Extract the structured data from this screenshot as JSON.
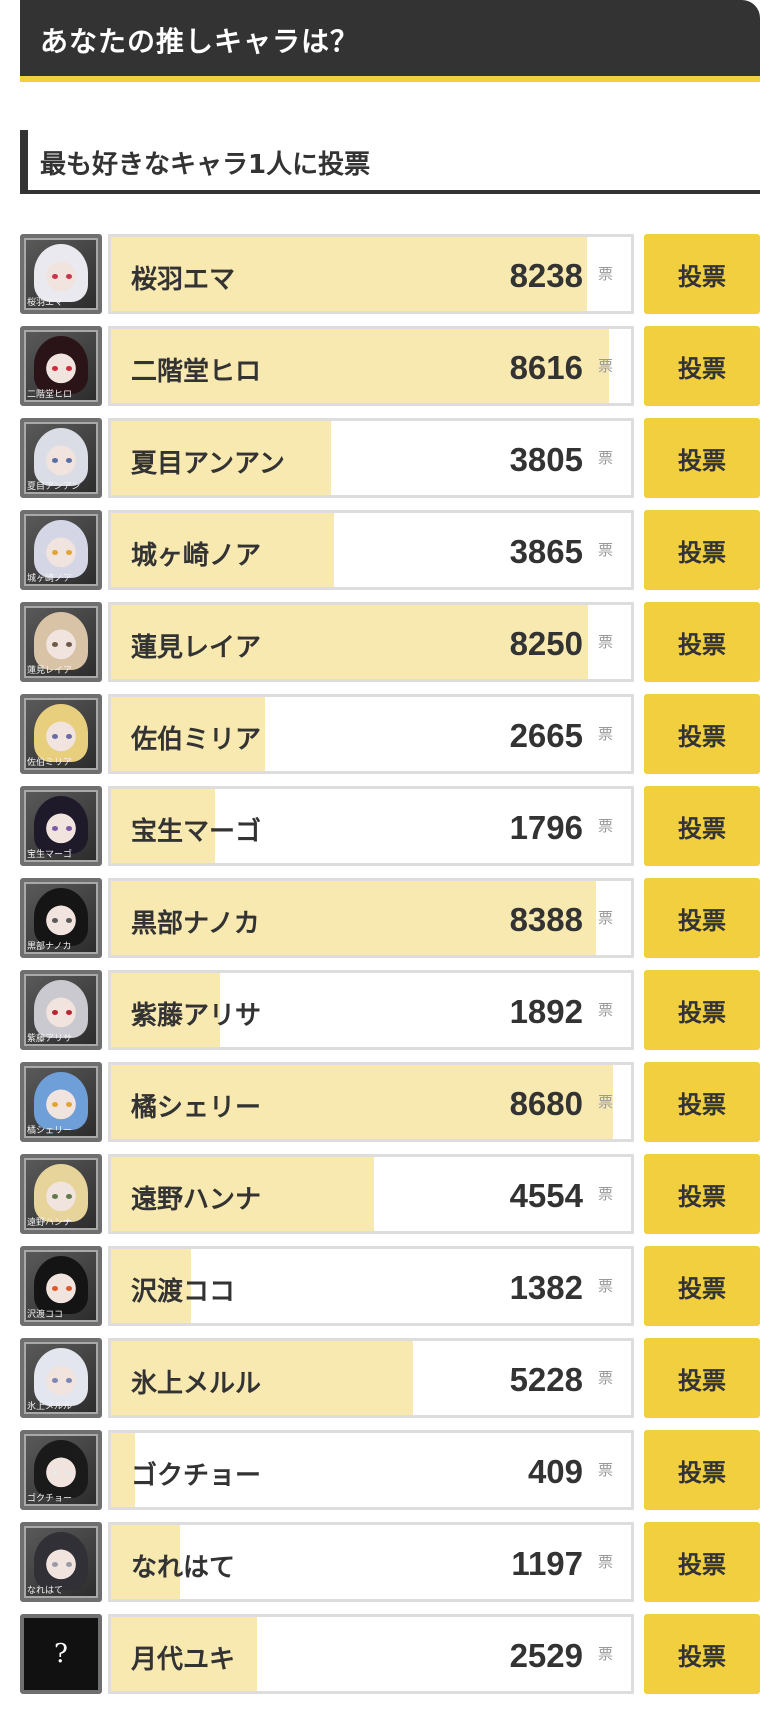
{
  "header": {
    "title": "あなたの推しキャラは？"
  },
  "subheading": {
    "title": "最も好きなキャラ1人に投票"
  },
  "vote_unit": "票",
  "vote_button_label": "投票",
  "max_votes": 9000,
  "characters": [
    {
      "name": "桜羽エマ",
      "votes": "8238",
      "tag": "桜羽エマ",
      "hair": "#e9e9ef",
      "eye": "#c8344a"
    },
    {
      "name": "二階堂ヒロ",
      "votes": "8616",
      "tag": "二階堂ヒロ",
      "hair": "#2a1418",
      "eye": "#d12a3c"
    },
    {
      "name": "夏目アンアン",
      "votes": "3805",
      "tag": "夏目アンアン",
      "hair": "#dadde6",
      "eye": "#5a6fa8"
    },
    {
      "name": "城ヶ崎ノア",
      "votes": "3865",
      "tag": "城ヶ崎ノア",
      "hair": "#d4d6e6",
      "eye": "#e1a531"
    },
    {
      "name": "蓮見レイア",
      "votes": "8250",
      "tag": "蓮見レイア",
      "hair": "#d8c3a6",
      "eye": "#6f5a4a"
    },
    {
      "name": "佐伯ミリア",
      "votes": "2665",
      "tag": "佐伯ミリア",
      "hair": "#e8cf7d",
      "eye": "#6c6aa8"
    },
    {
      "name": "宝生マーゴ",
      "votes": "1796",
      "tag": "宝生マーゴ",
      "hair": "#1f1a2a",
      "eye": "#7d5aa8"
    },
    {
      "name": "黒部ナノカ",
      "votes": "8388",
      "tag": "黒部ナノカ",
      "hair": "#151515",
      "eye": "#5a5a5a"
    },
    {
      "name": "紫藤アリサ",
      "votes": "1892",
      "tag": "紫藤アリサ",
      "hair": "#c9c9cf",
      "eye": "#b8252f"
    },
    {
      "name": "橘シェリー",
      "votes": "8680",
      "tag": "橘シェリー",
      "hair": "#6f9fd8",
      "eye": "#e1a531"
    },
    {
      "name": "遠野ハンナ",
      "votes": "4554",
      "tag": "遠野ハンナ",
      "hair": "#e7d49a",
      "eye": "#5f7c4a"
    },
    {
      "name": "沢渡ココ",
      "votes": "1382",
      "tag": "沢渡ココ",
      "hair": "#141414",
      "eye": "#e0592a"
    },
    {
      "name": "氷上メルル",
      "votes": "5228",
      "tag": "氷上メルル",
      "hair": "#e3e6ee",
      "eye": "#7a86b3"
    },
    {
      "name": "ゴクチョー",
      "votes": "409",
      "tag": "ゴクチョー",
      "hair": "#1a1a1a",
      "eye": "#e8e8e8"
    },
    {
      "name": "なれはて",
      "votes": "1197",
      "tag": "なれはて",
      "hair": "#303036",
      "eye": "#9a9aa8"
    },
    {
      "name": "月代ユキ",
      "votes": "2529",
      "tag": "?",
      "hair": "#000000",
      "eye": "#000000",
      "unknown": true
    }
  ],
  "colors": {
    "header_bg": "#333333",
    "accent_yellow": "#f2cf3e",
    "bar_fill": "#f8e9b0",
    "bar_border": "#dddddd"
  }
}
